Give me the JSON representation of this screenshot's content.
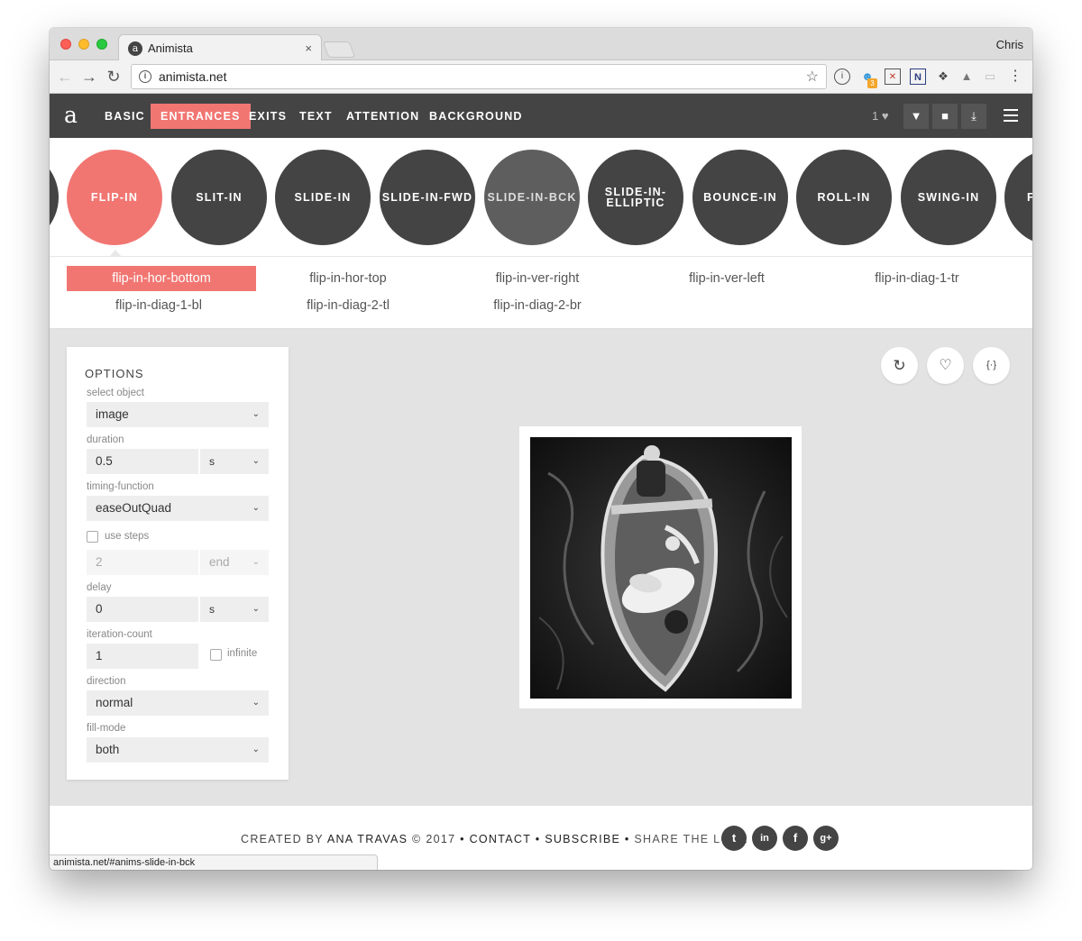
{
  "browser": {
    "tab_title": "Animista",
    "tab_close": "×",
    "favicon": "a",
    "profile": "Chris",
    "url": "animista.net",
    "status_url": "animista.net/#anims-slide-in-bck",
    "extension_badge": "3"
  },
  "nav": {
    "logo": "a",
    "links": [
      "BASIC",
      "ENTRANCES",
      "EXITS",
      "TEXT",
      "ATTENTION",
      "BACKGROUND"
    ],
    "active_link": "ENTRANCES",
    "favorites_count": "1"
  },
  "circles": [
    "FLIP-IN",
    "SLIT-IN",
    "SLIDE-IN",
    "SLIDE-IN-FWD",
    "SLIDE-IN-BCK",
    "SLIDE-IN-ELLIPTIC",
    "BOUNCE-IN",
    "ROLL-IN",
    "SWING-IN",
    "F"
  ],
  "circles_display": {
    "c0": "FLIP-IN",
    "c1": "SLIT-IN",
    "c2": "SLIDE-IN",
    "c3": "SLIDE-IN-FWD",
    "c4": "SLIDE-IN-BCK",
    "c5a": "SLIDE-IN-",
    "c5b": "ELLIPTIC",
    "c6": "BOUNCE-IN",
    "c7": "ROLL-IN",
    "c8": "SWING-IN",
    "c9": "F"
  },
  "variants": [
    "flip-in-hor-bottom",
    "flip-in-hor-top",
    "flip-in-ver-right",
    "flip-in-ver-left",
    "flip-in-diag-1-tr",
    "flip-in-diag-1-bl",
    "flip-in-diag-2-tl",
    "flip-in-diag-2-br"
  ],
  "active_variant": "flip-in-hor-bottom",
  "options": {
    "heading": "OPTIONS",
    "select_object_label": "select object",
    "select_object_value": "image",
    "duration_label": "duration",
    "duration_value": "0.5",
    "duration_unit": "s",
    "timing_label": "timing-function",
    "timing_value": "easeOutQuad",
    "use_steps_label": "use steps",
    "use_steps_checked": false,
    "steps_value": "2",
    "steps_position": "end",
    "delay_label": "delay",
    "delay_value": "0",
    "delay_unit": "s",
    "iteration_label": "iteration-count",
    "iteration_value": "1",
    "infinite_label": "infinite",
    "infinite_checked": false,
    "direction_label": "direction",
    "direction_value": "normal",
    "fill_mode_label": "fill-mode",
    "fill_mode_value": "both"
  },
  "actions": {
    "replay_icon": "replay-icon",
    "favorite_icon": "heart-icon",
    "code_label": "{·}"
  },
  "footer": {
    "created_by": "CREATED BY",
    "author": "ANA TRAVAS",
    "copyright": "© 2017",
    "contact": "CONTACT",
    "subscribe": "SUBSCRIBE",
    "share": "SHARE THE LOVE",
    "sep": "•",
    "social": [
      "twitter-icon",
      "linkedin-icon",
      "facebook-icon",
      "google-plus-icon"
    ],
    "social_glyphs": {
      "twitter": "t",
      "linkedin": "in",
      "facebook": "f",
      "google_plus": "g+"
    }
  },
  "colors": {
    "accent": "#f17672",
    "nav_bg": "#444444",
    "workspace_bg": "#e3e3e3"
  }
}
